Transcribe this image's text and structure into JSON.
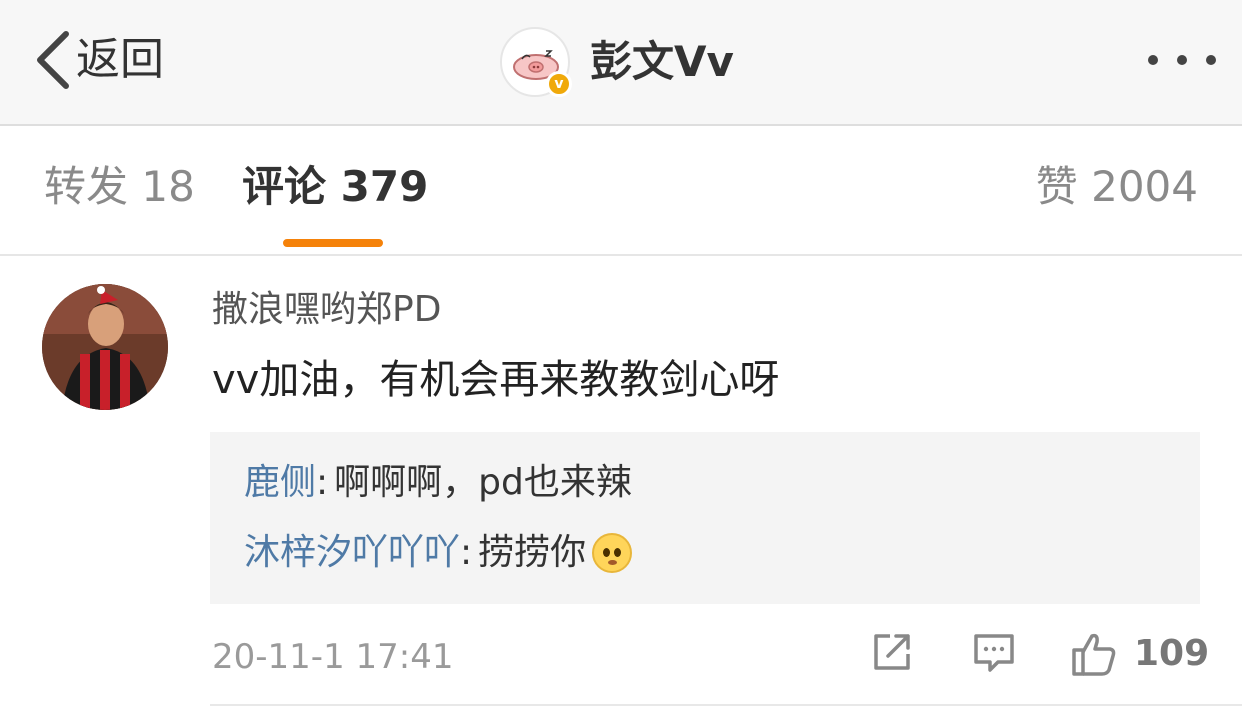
{
  "header": {
    "back_label": "返回",
    "title": "彭文Vv",
    "verified_mark": "v",
    "more_icon": "more-dots-icon"
  },
  "tabs": [
    {
      "label": "转发 18",
      "active": false
    },
    {
      "label": "评论 379",
      "active": true
    },
    {
      "label": "赞 2004",
      "active": false
    }
  ],
  "accent_color": "#f5820a",
  "comment": {
    "username": "撒浪嘿哟郑PD",
    "text": "vv加油，有机会再来教教剑心呀",
    "replies": [
      {
        "user": "鹿侧",
        "text": "啊啊啊，pd也来辣",
        "emoji": ""
      },
      {
        "user": "沐梓汐吖吖吖",
        "text": "捞捞你",
        "emoji": "pleading-face"
      }
    ],
    "timestamp": "20-11-1 17:41",
    "like_count": "109",
    "link_color": "#4f7aa6"
  }
}
